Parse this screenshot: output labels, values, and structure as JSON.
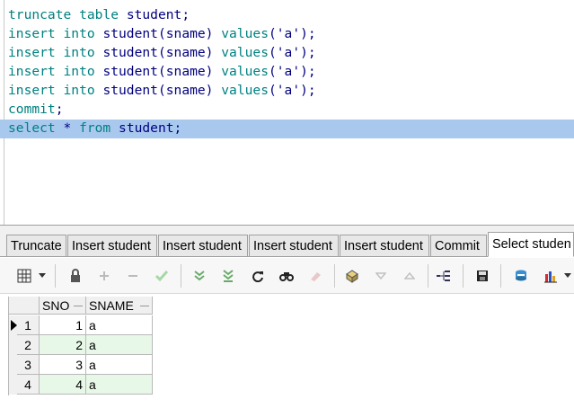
{
  "editor": {
    "lines": [
      {
        "tokens": [
          {
            "t": "truncate table",
            "c": "kw"
          },
          {
            "t": " ",
            "c": "sym"
          },
          {
            "t": "student;",
            "c": "id"
          }
        ]
      },
      {
        "tokens": [
          {
            "t": "insert into",
            "c": "kw"
          },
          {
            "t": " ",
            "c": "sym"
          },
          {
            "t": "student(sname)",
            "c": "id"
          },
          {
            "t": " ",
            "c": "sym"
          },
          {
            "t": "values",
            "c": "kw"
          },
          {
            "t": "('a');",
            "c": "str"
          }
        ]
      },
      {
        "tokens": [
          {
            "t": "insert into",
            "c": "kw"
          },
          {
            "t": " ",
            "c": "sym"
          },
          {
            "t": "student(sname)",
            "c": "id"
          },
          {
            "t": " ",
            "c": "sym"
          },
          {
            "t": "values",
            "c": "kw"
          },
          {
            "t": "('a');",
            "c": "str"
          }
        ]
      },
      {
        "tokens": [
          {
            "t": "insert into",
            "c": "kw"
          },
          {
            "t": " ",
            "c": "sym"
          },
          {
            "t": "student(sname)",
            "c": "id"
          },
          {
            "t": " ",
            "c": "sym"
          },
          {
            "t": "values",
            "c": "kw"
          },
          {
            "t": "('a');",
            "c": "str"
          }
        ]
      },
      {
        "tokens": [
          {
            "t": "insert into",
            "c": "kw"
          },
          {
            "t": " ",
            "c": "sym"
          },
          {
            "t": "student(sname)",
            "c": "id"
          },
          {
            "t": " ",
            "c": "sym"
          },
          {
            "t": "values",
            "c": "kw"
          },
          {
            "t": "('a');",
            "c": "str"
          }
        ]
      },
      {
        "tokens": [
          {
            "t": "commit",
            "c": "kw"
          },
          {
            "t": ";",
            "c": "sym"
          }
        ]
      },
      {
        "tokens": [
          {
            "t": "select",
            "c": "kw"
          },
          {
            "t": " * ",
            "c": "sym"
          },
          {
            "t": "from",
            "c": "kw"
          },
          {
            "t": " ",
            "c": "sym"
          },
          {
            "t": "student;",
            "c": "id"
          }
        ],
        "selected": true
      }
    ]
  },
  "tabs": [
    {
      "label": "Truncate"
    },
    {
      "label": "Insert student"
    },
    {
      "label": "Insert student"
    },
    {
      "label": "Insert student"
    },
    {
      "label": "Insert student"
    },
    {
      "label": "Commit"
    },
    {
      "label": "Select studen",
      "active": true
    }
  ],
  "toolbar": {
    "icons": [
      "grid-view-icon",
      "dropdown-arrow-icon",
      "lock-icon",
      "add-record-icon",
      "delete-record-icon",
      "post-check-icon",
      "fetch-next-icon",
      "fetch-all-icon",
      "refresh-icon",
      "find-icon",
      "clear-icon",
      "query-by-example-icon",
      "sort-down-icon",
      "sort-up-icon",
      "tree-icon",
      "save-icon",
      "export-icon",
      "chart-icon"
    ]
  },
  "grid": {
    "columns": [
      "SNO",
      "SNAME"
    ],
    "rows": [
      {
        "num": "1",
        "sno": "1",
        "sname": "a",
        "current": true
      },
      {
        "num": "2",
        "sno": "2",
        "sname": "a"
      },
      {
        "num": "3",
        "sno": "3",
        "sname": "a"
      },
      {
        "num": "4",
        "sno": "4",
        "sname": "a"
      }
    ]
  },
  "colors": {
    "selection": "#a8c8ee",
    "keyword": "#008080",
    "identifier": "#000080",
    "row_alt": "#e8f8e8"
  }
}
